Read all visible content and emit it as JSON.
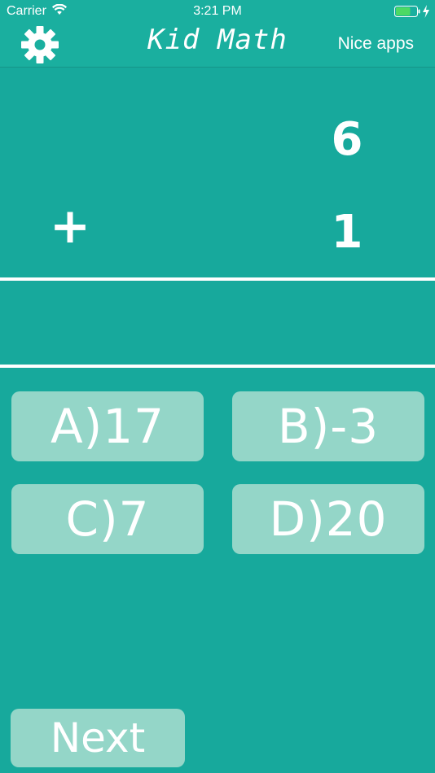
{
  "status_bar": {
    "carrier": "Carrier",
    "time": "3:21 PM",
    "battery_level": 0.7
  },
  "nav_bar": {
    "settings_icon": "gear-icon",
    "title": "Kid Math",
    "nice_apps_label": "Nice apps"
  },
  "problem": {
    "top_operand": "6",
    "operator": "+",
    "bottom_operand": "1",
    "answer": ""
  },
  "choices": [
    {
      "label": "A)17"
    },
    {
      "label": "B)-3"
    },
    {
      "label": "C)7"
    },
    {
      "label": "D)20"
    }
  ],
  "next_label": "Next",
  "colors": {
    "background": "#17a99c",
    "button": "#94d6c8",
    "text": "#ffffff",
    "divider": "#ffffff"
  }
}
